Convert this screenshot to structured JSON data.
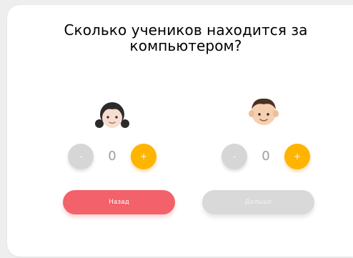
{
  "question": {
    "title_line1": "Сколько учеников находится за",
    "title_line2": "компьютером?"
  },
  "counters": [
    {
      "icon": "girl-icon",
      "minus_label": "-",
      "value": "0",
      "plus_label": "+"
    },
    {
      "icon": "boy-icon",
      "minus_label": "-",
      "value": "0",
      "plus_label": "+"
    }
  ],
  "actions": {
    "back_label": "Назад",
    "next_label": "Дальше"
  },
  "colors": {
    "plus": "#ffb400",
    "minus": "#d6d6d6",
    "back": "#f3616a",
    "next_disabled": "#d9d9d9"
  }
}
